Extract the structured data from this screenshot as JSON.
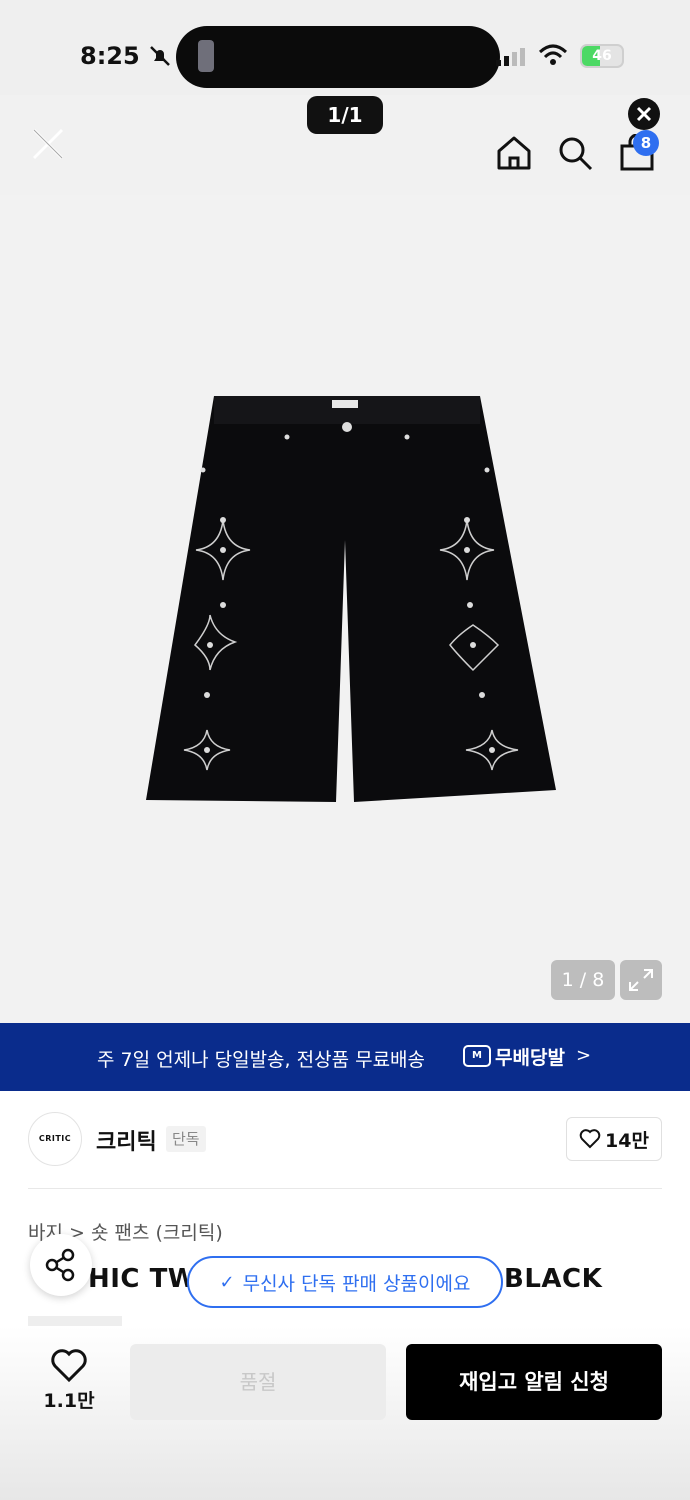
{
  "status_bar": {
    "time": "8:25",
    "battery": "46",
    "battery_level": 0.46
  },
  "top": {
    "image_counter": "1/1",
    "cart_count": "8"
  },
  "image": {
    "counter": "1 / 8"
  },
  "banner": {
    "text": "주 7일 언제나 당일발송, 전상품 무료배송",
    "logo_mark": "M",
    "logo_text": "무배당발",
    "chevron": ">"
  },
  "brand": {
    "logo_text": "CRITIC",
    "name": "크리틱",
    "tag": "단독",
    "likes": "14만"
  },
  "product": {
    "breadcrumb": "바지 > 숏 팬츠 (크리틱)",
    "title_left": "HIC TW",
    "title_right": "BLACK"
  },
  "toast": {
    "text": "무신사 단독 판매 상품이에요"
  },
  "bottom": {
    "wish_count": "1.1만",
    "soldout_label": "품절",
    "restock_label": "재입고 알림 신청"
  },
  "colors": {
    "banner": "#0a2c8c",
    "accent": "#2f6ff0",
    "primary_button": "#000000"
  },
  "icons": [
    "close-icon",
    "home-icon",
    "search-icon",
    "cart-icon",
    "expand-icon",
    "share-icon",
    "heart-icon",
    "check-icon"
  ]
}
